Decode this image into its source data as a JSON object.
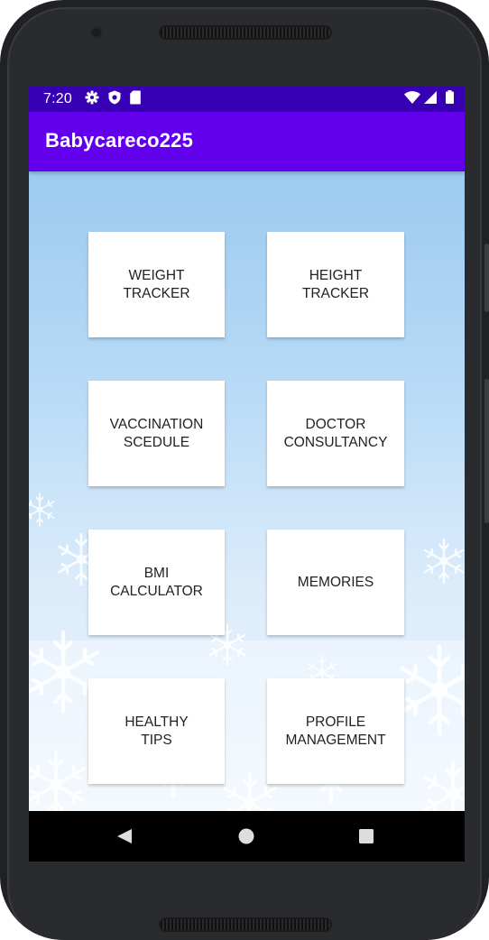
{
  "status_bar": {
    "time": "7:20",
    "left_icons": [
      "gear-icon",
      "shield-icon",
      "sd-card-icon"
    ],
    "right_icons": [
      "wifi-icon",
      "cell-signal-icon",
      "battery-icon"
    ],
    "color": "#3700b3"
  },
  "app_bar": {
    "title": "Babycareco225",
    "color": "#6200ee"
  },
  "tiles": [
    {
      "label": "WEIGHT\nTRACKER"
    },
    {
      "label": "HEIGHT\nTRACKER"
    },
    {
      "label": "VACCINATION\nSCEDULE"
    },
    {
      "label": "DOCTOR\nCONSULTANCY"
    },
    {
      "label": "BMI\nCALCULATOR"
    },
    {
      "label": "MEMORIES"
    },
    {
      "label": "HEALTHY\nTIPS"
    },
    {
      "label": "PROFILE\nMANAGEMENT"
    }
  ],
  "nav_bar": {
    "buttons": [
      "back-icon",
      "home-icon",
      "recents-icon"
    ]
  }
}
